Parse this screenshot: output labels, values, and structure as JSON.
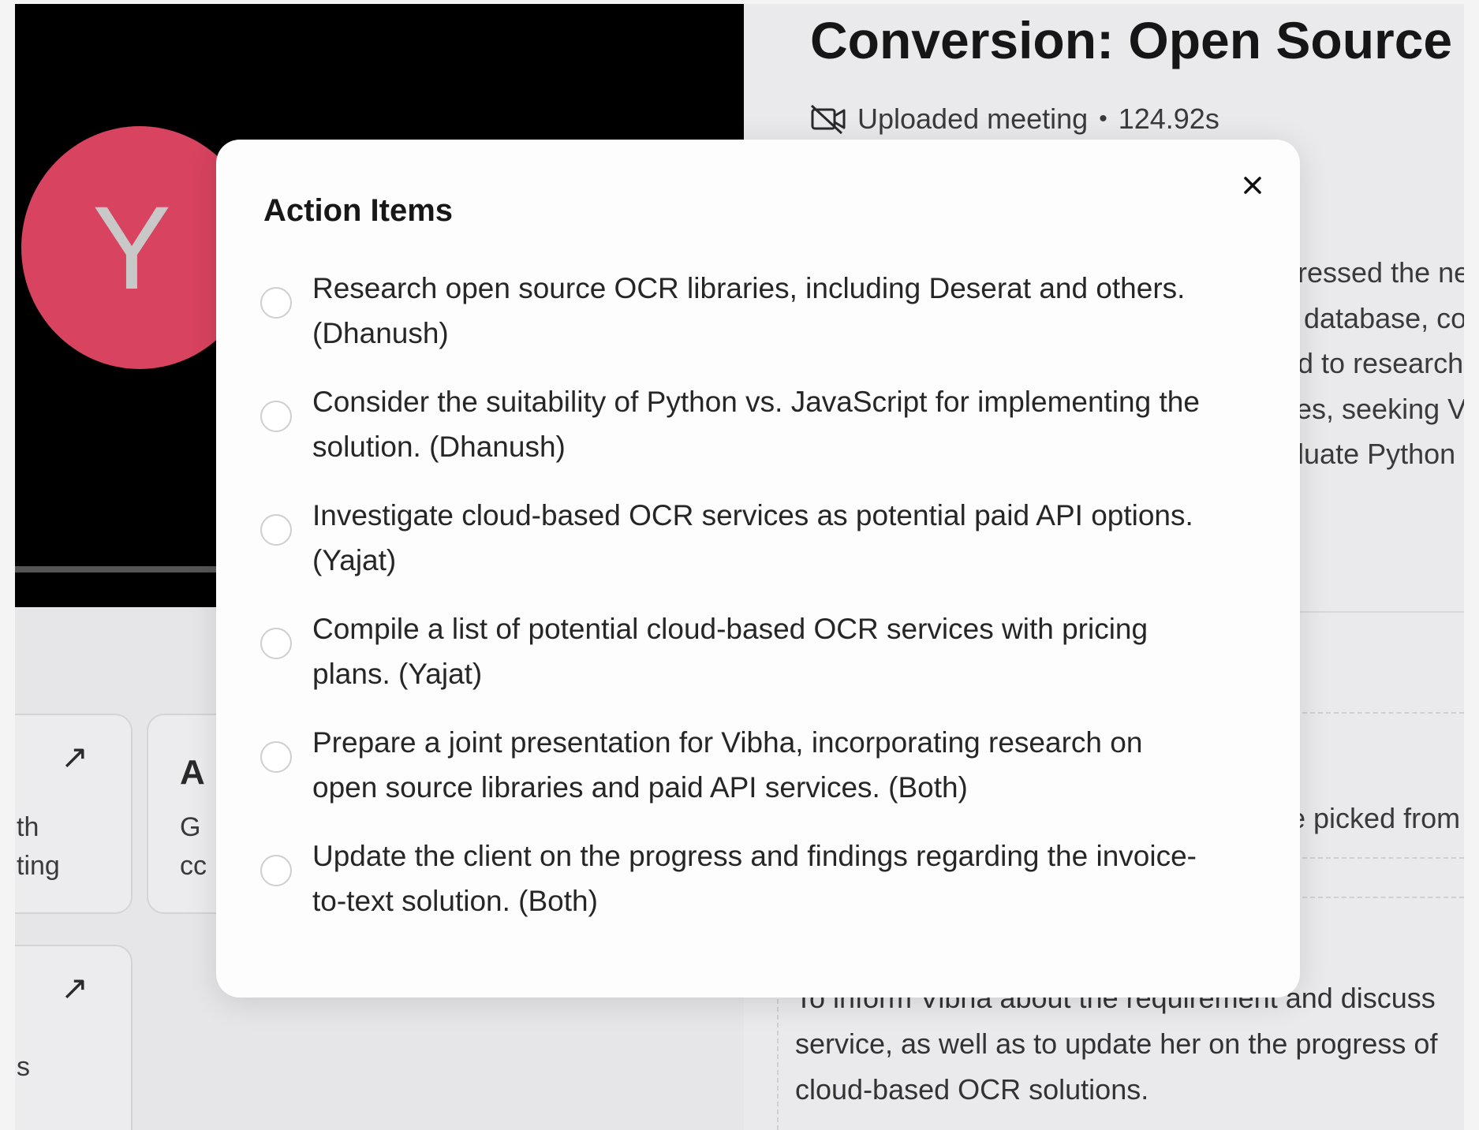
{
  "avatar": {
    "initial": "Y",
    "color": "#d8435f"
  },
  "cards": [
    {
      "line1": "th",
      "line2": "ting"
    },
    {
      "heading": "A",
      "line1": "G",
      "line2": "cc"
    },
    {
      "line1": "s"
    }
  ],
  "meeting": {
    "title": "Conversion: Open Source",
    "source": "Uploaded meeting",
    "duration": "124.92s"
  },
  "summary_peek": [
    "dressed the ne",
    "s database, co",
    "ed to research",
    "ces, seeking V",
    "aluate Python"
  ],
  "picked_peek": "e picked from v",
  "bottom_text": [
    "To inform Vibha about the requirement and discuss",
    "service, as well as to update her on the progress of",
    "cloud-based OCR solutions."
  ],
  "modal": {
    "title": "Action Items",
    "items": [
      {
        "line1": "Research open source OCR libraries, including Deserat and others.",
        "line2": "(Dhanush)"
      },
      {
        "line1": "Consider the suitability of Python vs. JavaScript for implementing the",
        "line2": "solution. (Dhanush)"
      },
      {
        "line1": "Investigate cloud-based OCR services as potential paid API options.",
        "line2": "(Yajat)"
      },
      {
        "line1": "Compile a list of potential cloud-based OCR services with pricing",
        "line2": "plans. (Yajat)"
      },
      {
        "line1": "Prepare a joint presentation for Vibha, incorporating research on",
        "line2": "open source libraries and paid API services. (Both)"
      },
      {
        "line1": "Update the client on the progress and findings regarding the invoice-",
        "line2": "to-text solution. (Both)"
      }
    ]
  }
}
